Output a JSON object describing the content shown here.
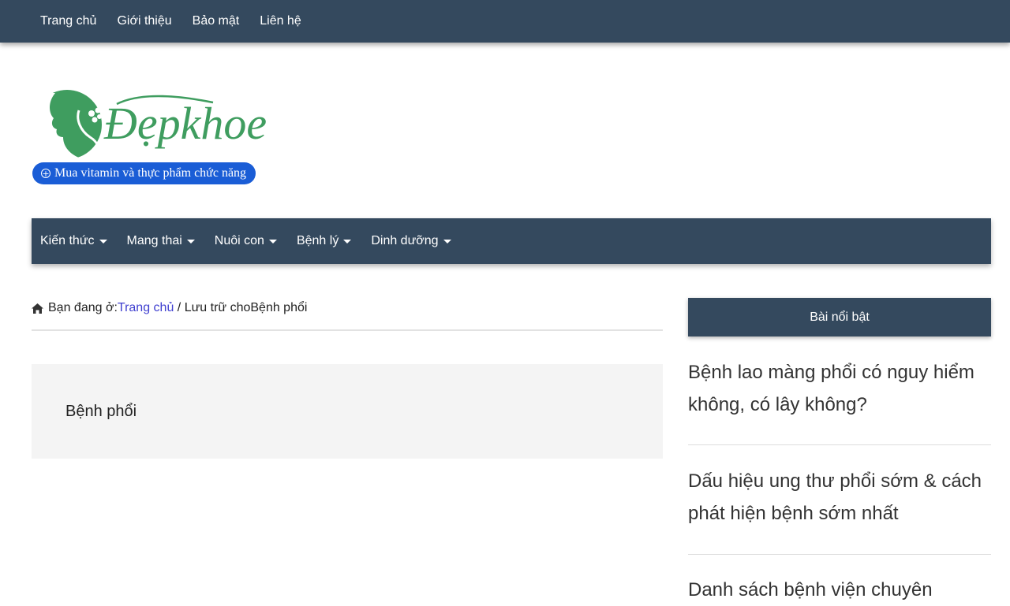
{
  "top_nav": {
    "items": [
      "Trang chủ",
      "Giới thiệu",
      "Bảo mật",
      "Liên hệ"
    ]
  },
  "logo": {
    "text": "Đẹpkhoe",
    "color": "#3f9d5f"
  },
  "shop_button": {
    "label": "Mua vitamin và thực phẩm chức năng",
    "icon": "plus-circle-icon",
    "color": "#1a5dd6"
  },
  "main_nav": {
    "items": [
      "Kiến thức",
      "Mang thai",
      "Nuôi con",
      "Bệnh lý",
      "Dinh dưỡng"
    ],
    "background": "#34495e"
  },
  "breadcrumb": {
    "prefix": "Bạn đang ở:",
    "home_link": "Trang chủ",
    "separator": " / ",
    "archive_text": "Lưu trữ choBệnh phổi",
    "icon": "home-icon"
  },
  "archive": {
    "title": "Bệnh phổi"
  },
  "sidebar": {
    "heading": "Bài nổi bật",
    "posts": [
      "Bệnh lao màng phổi có nguy hiểm không, có lây không?",
      "Dấu hiệu ung thư phổi sớm & cách phát hiện bệnh sớm nhất",
      "Danh sách bệnh viện chuyên"
    ]
  }
}
